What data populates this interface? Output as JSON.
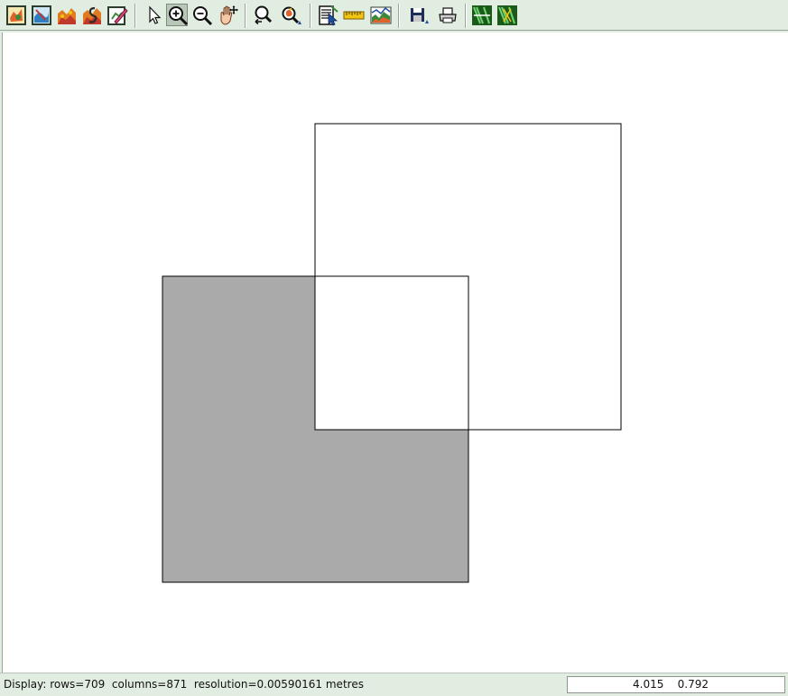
{
  "toolbar": {
    "tools": [
      {
        "name": "display-map-icon"
      },
      {
        "name": "overlay-map-icon"
      },
      {
        "name": "raster-map-icon"
      },
      {
        "name": "vector-map-icon"
      },
      {
        "name": "erase-display-icon"
      },
      {
        "name": "pointer-icon"
      },
      {
        "name": "zoom-in-icon",
        "active": true
      },
      {
        "name": "zoom-out-icon"
      },
      {
        "name": "pan-icon"
      },
      {
        "name": "zoom-back-icon"
      },
      {
        "name": "zoom-menu-icon"
      },
      {
        "name": "query-icon"
      },
      {
        "name": "measure-icon"
      },
      {
        "name": "profile-icon"
      },
      {
        "name": "save-icon"
      },
      {
        "name": "print-icon"
      },
      {
        "name": "analysis-1-icon"
      },
      {
        "name": "analysis-2-icon"
      }
    ]
  },
  "canvas": {
    "gray_square_color": "#aaaaaa",
    "outline_color": "#000000"
  },
  "status": {
    "display_info": "Display: rows=709  columns=871  resolution=0.00590161 metres",
    "coordinates": "4.015    0.792"
  }
}
